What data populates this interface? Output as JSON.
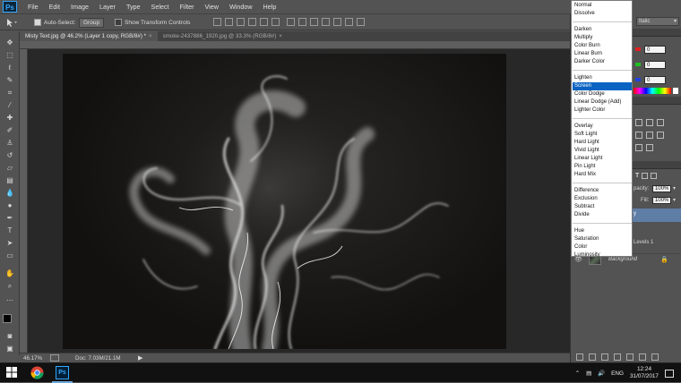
{
  "menubar": {
    "logo": "Ps",
    "items": [
      "File",
      "Edit",
      "Image",
      "Layer",
      "Type",
      "Select",
      "Filter",
      "View",
      "Window",
      "Help"
    ]
  },
  "options": {
    "auto_select_label": "Auto-Select:",
    "auto_select_checked": true,
    "group_value": "Group",
    "show_transform_label": "Show Transform Controls",
    "show_transform_checked": false
  },
  "tabs": [
    {
      "label": "Misty Text.jpg @ 46.2% (Layer 1 copy, RGB/8#) *",
      "active": true
    },
    {
      "label": "smoke-2437886_1920.jpg @ 33.3% (RGB/8#)",
      "active": false
    }
  ],
  "statusbar": {
    "zoom": "46.17%",
    "doc": "Doc: 7.03M/21.1M"
  },
  "blend_modes": {
    "highlighted": "Screen",
    "groups": [
      [
        "Normal",
        "Dissolve"
      ],
      [
        "Darken",
        "Multiply",
        "Color Burn",
        "Linear Burn",
        "Darker Color"
      ],
      [
        "Lighten",
        "Screen",
        "Color Dodge",
        "Linear Dodge (Add)",
        "Lighter Color"
      ],
      [
        "Overlay",
        "Soft Light",
        "Hard Light",
        "Vivid Light",
        "Linear Light",
        "Pin Light",
        "Hard Mix"
      ],
      [
        "Difference",
        "Exclusion",
        "Subtract",
        "Divide"
      ],
      [
        "Hue",
        "Saturation",
        "Color",
        "Luminosity"
      ]
    ]
  },
  "right_panel": {
    "workspace_fragment": "Italic",
    "color_values": [
      "0",
      "0",
      "0"
    ],
    "opacity_label": "pacity:",
    "opacity_value": "100%",
    "fill_label": "Fill:",
    "fill_value": "100%",
    "layer_fragment": "y",
    "levels_fragment": "Levels 1",
    "background_layer": "Background"
  },
  "taskbar": {
    "language": "ENG",
    "time": "12:24",
    "date": "31/07/2017"
  },
  "colors": {
    "accent": "#0a63c2",
    "chrome_bg": "#535353",
    "canvas_bg": "#282828",
    "taskbar_bg": "#111111"
  }
}
